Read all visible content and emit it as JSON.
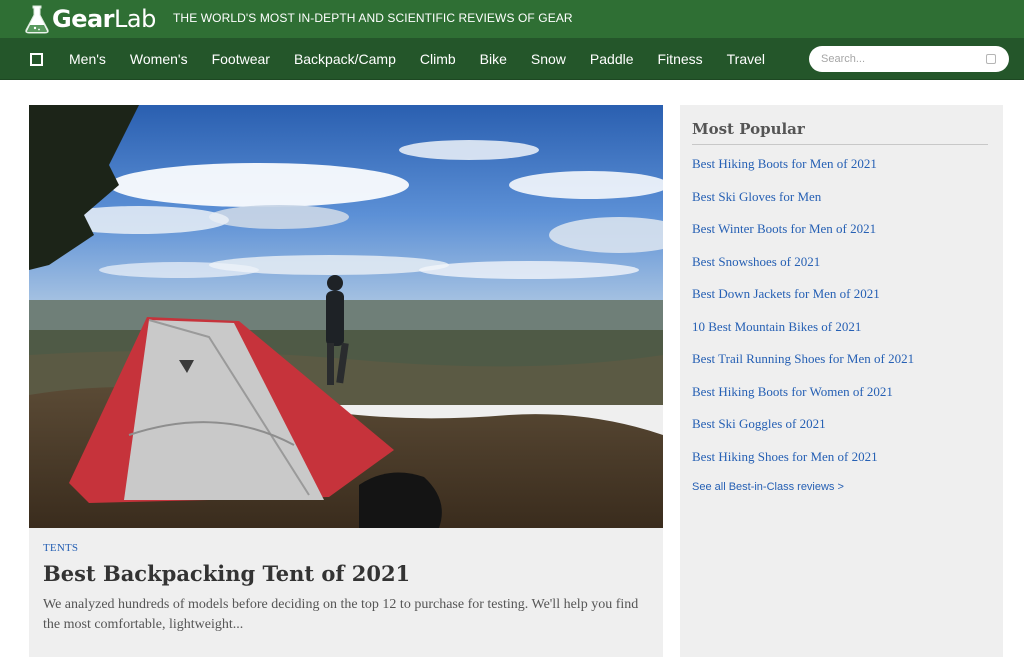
{
  "header": {
    "logo_bold": "Gear",
    "logo_light": "Lab",
    "tagline": "THE WORLD'S MOST IN-DEPTH AND SCIENTIFIC REVIEWS OF GEAR"
  },
  "nav": {
    "menu_icon": "menu-checkbox-icon",
    "items": [
      "Men's",
      "Women's",
      "Footwear",
      "Backpack/Camp",
      "Climb",
      "Bike",
      "Snow",
      "Paddle",
      "Fitness",
      "Travel"
    ]
  },
  "search": {
    "placeholder": "Search...",
    "value": ""
  },
  "hero": {
    "image": "tent-on-hilltop-photo",
    "category": "TENTS",
    "title": "Best Backpacking Tent of 2021",
    "excerpt": "We analyzed hundreds of models before deciding on the top 12 to purchase for testing. We'll help you find the most comfortable, lightweight..."
  },
  "sidebar": {
    "title": "Most Popular",
    "links": [
      "Best Hiking Boots for Men of 2021",
      "Best Ski Gloves for Men",
      "Best Winter Boots for Men of 2021",
      "Best Snowshoes of 2021",
      "Best Down Jackets for Men of 2021",
      "10 Best Mountain Bikes of 2021",
      "Best Trail Running Shoes for Men of 2021",
      "Best Hiking Boots for Women of 2021",
      "Best Ski Goggles of 2021",
      "Best Hiking Shoes for Men of 2021"
    ],
    "see_all": "See all Best-in-Class reviews >"
  },
  "colors": {
    "header_green": "#2f6f34",
    "nav_green": "#24562a",
    "link_blue": "#2660b4",
    "card_bg": "#efefef"
  }
}
